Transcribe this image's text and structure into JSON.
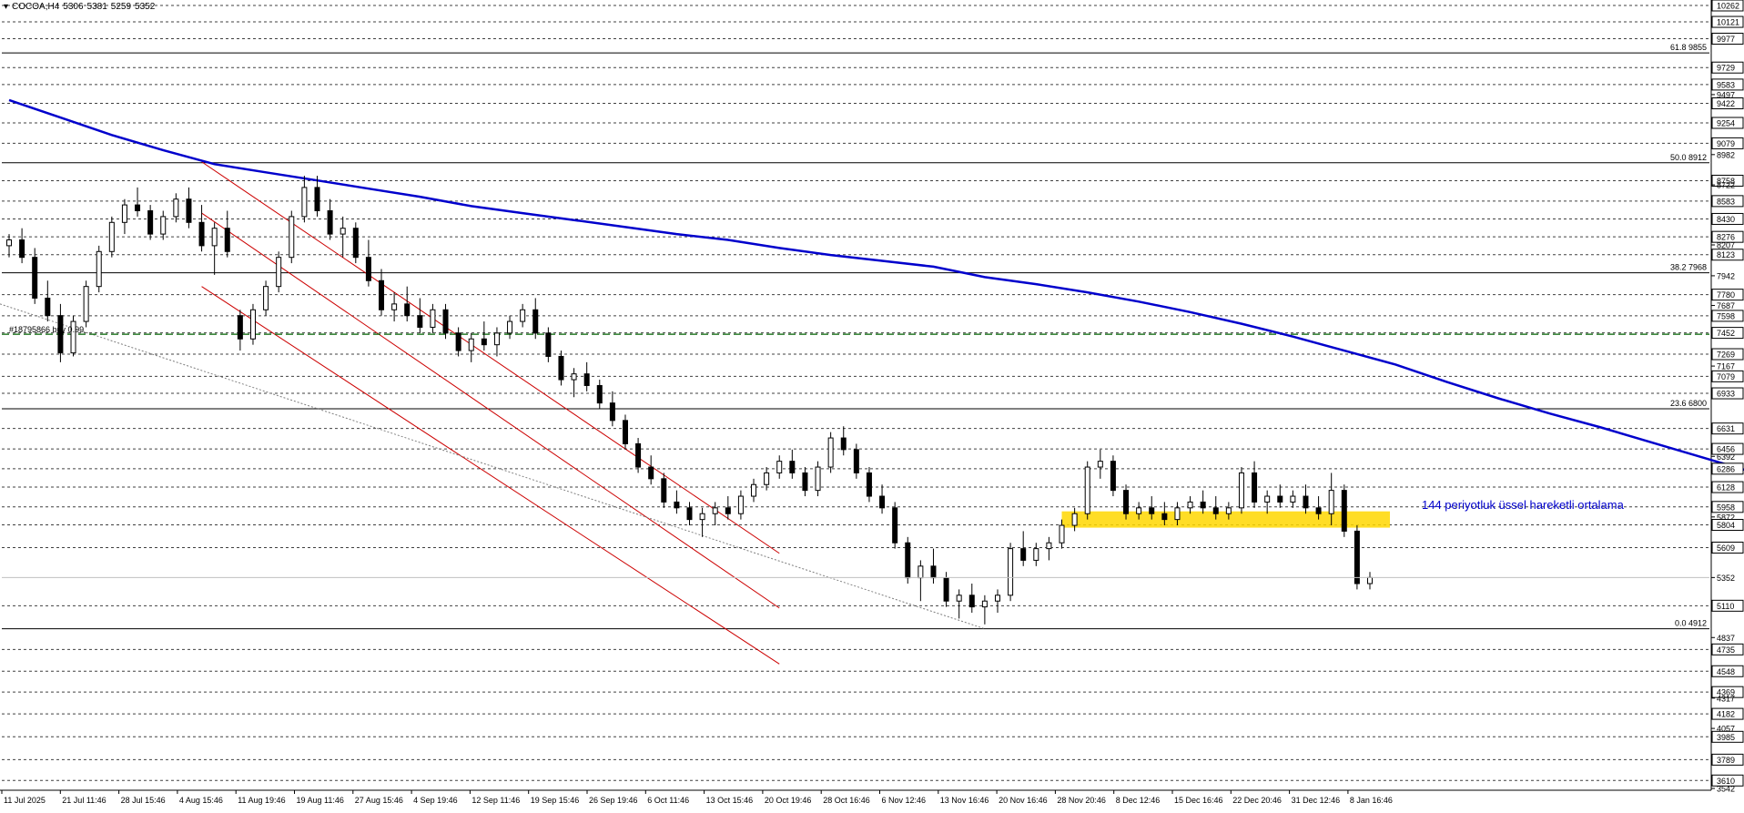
{
  "header": {
    "symbol": "COCOA,H4",
    "ohlc": [
      "5306",
      "5381",
      "5259",
      "5352"
    ]
  },
  "annotations": {
    "ema_label": "144 periyotluk üssel hareketli ortalama",
    "order_label": "#18795866 buy 0.99"
  },
  "colors": {
    "background": "#ffffff",
    "candle": "#000000",
    "ema": "#0000cc",
    "channel": "#cc0000",
    "fib": "#000000",
    "order_line": "#006400",
    "zone": "#ffd700",
    "grid": "#000000",
    "support_line": "#808080"
  },
  "chart_data": {
    "type": "candlestick",
    "instrument": "COCOA",
    "timeframe": "H4",
    "grid": true,
    "ylim": [
      3542,
      10262
    ],
    "price_axis_labels": [
      "10262",
      "10121",
      "9977",
      "9729",
      "9583",
      "9497",
      "9422",
      "9254",
      "9079",
      "8982",
      "8758",
      "8722",
      "8583",
      "8430",
      "8276",
      "8207",
      "8123",
      "7942",
      "7780",
      "7687",
      "7598",
      "7452",
      "7269",
      "7167",
      "7079",
      "6933",
      "6631",
      "6456",
      "6392",
      "6286",
      "6128",
      "5958",
      "5872",
      "5804",
      "5609",
      "5352",
      "5110",
      "4837",
      "4735",
      "4548",
      "4369",
      "4317",
      "4182",
      "4057",
      "3985",
      "3789",
      "3610",
      "3542"
    ],
    "dashed_grid_levels": [
      10262,
      10121,
      9977,
      9729,
      9583,
      9422,
      9254,
      9079,
      8758,
      8583,
      8430,
      8276,
      8123,
      7780,
      7598,
      7452,
      7269,
      7079,
      6933,
      6631,
      6456,
      6286,
      6128,
      5958,
      5804,
      5609,
      5110,
      4735,
      4548,
      4369,
      4182,
      3985,
      3789,
      3610
    ],
    "time_axis_labels": [
      "11 Jul 2025",
      "21 Jul 11:46",
      "28 Jul 15:46",
      "4 Aug 15:46",
      "11 Aug 19:46",
      "19 Aug 11:46",
      "27 Aug 15:46",
      "4 Sep 19:46",
      "12 Sep 11:46",
      "19 Sep 15:46",
      "26 Sep 19:46",
      "6 Oct 11:46",
      "13 Oct 15:46",
      "20 Oct 19:46",
      "28 Oct 16:46",
      "6 Nov 12:46",
      "13 Nov 16:46",
      "20 Nov 16:46",
      "28 Nov 20:46",
      "8 Dec 12:46",
      "15 Dec 16:46",
      "22 Dec 20:46",
      "31 Dec 12:46",
      "8 Jan 16:46"
    ],
    "fibonacci_levels": [
      {
        "label": "61.8 9855",
        "price": 9855
      },
      {
        "label": "50.0 8912",
        "price": 8912
      },
      {
        "label": "38.2 7968",
        "price": 7968
      },
      {
        "label": "23.6 6800",
        "price": 6800
      },
      {
        "label": "0.0 4912",
        "price": 4912
      }
    ],
    "order_level": {
      "label": "#18795866 buy 0.99",
      "price": 7440
    },
    "current_price": 5352,
    "ema_period": 144,
    "ema_points": [
      [
        0,
        9450
      ],
      [
        4,
        9300
      ],
      [
        8,
        9150
      ],
      [
        12,
        9020
      ],
      [
        16,
        8900
      ],
      [
        20,
        8830
      ],
      [
        24,
        8760
      ],
      [
        28,
        8690
      ],
      [
        32,
        8620
      ],
      [
        36,
        8540
      ],
      [
        40,
        8480
      ],
      [
        44,
        8420
      ],
      [
        48,
        8360
      ],
      [
        52,
        8300
      ],
      [
        56,
        8250
      ],
      [
        60,
        8180
      ],
      [
        64,
        8120
      ],
      [
        68,
        8070
      ],
      [
        72,
        8020
      ],
      [
        76,
        7930
      ],
      [
        80,
        7870
      ],
      [
        84,
        7800
      ],
      [
        88,
        7720
      ],
      [
        92,
        7630
      ],
      [
        96,
        7530
      ],
      [
        100,
        7420
      ],
      [
        104,
        7300
      ],
      [
        108,
        7180
      ],
      [
        112,
        7030
      ],
      [
        116,
        6890
      ],
      [
        120,
        6760
      ],
      [
        124,
        6640
      ],
      [
        128,
        6510
      ],
      [
        132,
        6380
      ],
      [
        136,
        6250
      ],
      [
        140,
        6110
      ],
      [
        144,
        5990
      ],
      [
        148,
        5900
      ],
      [
        152,
        5870
      ],
      [
        156,
        5860
      ],
      [
        160,
        5860
      ],
      [
        164,
        5865
      ],
      [
        168,
        5870
      ],
      [
        172,
        5870
      ],
      [
        176,
        5862
      ],
      [
        180,
        5860
      ],
      [
        184,
        5855
      ]
    ],
    "candles": [
      [
        0,
        8200,
        8300,
        8100,
        8250
      ],
      [
        1,
        8250,
        8350,
        8050,
        8100
      ],
      [
        2,
        8100,
        8180,
        7700,
        7750
      ],
      [
        3,
        7750,
        7900,
        7550,
        7600
      ],
      [
        4,
        7600,
        7700,
        7200,
        7280
      ],
      [
        5,
        7280,
        7600,
        7250,
        7550
      ],
      [
        6,
        7550,
        7900,
        7500,
        7850
      ],
      [
        7,
        7850,
        8200,
        7800,
        8150
      ],
      [
        8,
        8150,
        8450,
        8100,
        8400
      ],
      [
        9,
        8400,
        8600,
        8300,
        8550
      ],
      [
        10,
        8550,
        8700,
        8450,
        8500
      ],
      [
        11,
        8500,
        8550,
        8250,
        8300
      ],
      [
        12,
        8300,
        8500,
        8250,
        8450
      ],
      [
        13,
        8450,
        8650,
        8400,
        8600
      ],
      [
        14,
        8600,
        8700,
        8350,
        8400
      ],
      [
        15,
        8400,
        8550,
        8150,
        8200
      ],
      [
        16,
        8200,
        8400,
        7950,
        8350
      ],
      [
        17,
        8350,
        8500,
        8100,
        8150
      ],
      [
        18,
        7600,
        7650,
        7300,
        7400
      ],
      [
        19,
        7400,
        7700,
        7350,
        7650
      ],
      [
        20,
        7650,
        7900,
        7600,
        7850
      ],
      [
        21,
        7850,
        8150,
        7800,
        8100
      ],
      [
        22,
        8100,
        8500,
        8050,
        8450
      ],
      [
        23,
        8450,
        8800,
        8400,
        8700
      ],
      [
        24,
        8700,
        8800,
        8450,
        8500
      ],
      [
        25,
        8500,
        8600,
        8250,
        8300
      ],
      [
        26,
        8300,
        8450,
        8100,
        8350
      ],
      [
        27,
        8350,
        8400,
        8050,
        8100
      ],
      [
        28,
        8100,
        8250,
        7850,
        7900
      ],
      [
        29,
        7900,
        8000,
        7600,
        7650
      ],
      [
        30,
        7650,
        7800,
        7550,
        7700
      ],
      [
        31,
        7700,
        7850,
        7550,
        7600
      ],
      [
        32,
        7600,
        7750,
        7450,
        7500
      ],
      [
        33,
        7500,
        7700,
        7450,
        7650
      ],
      [
        34,
        7650,
        7700,
        7400,
        7450
      ],
      [
        35,
        7450,
        7500,
        7250,
        7300
      ],
      [
        36,
        7300,
        7450,
        7200,
        7400
      ],
      [
        37,
        7400,
        7550,
        7300,
        7350
      ],
      [
        38,
        7350,
        7500,
        7250,
        7450
      ],
      [
        39,
        7450,
        7600,
        7400,
        7550
      ],
      [
        40,
        7550,
        7700,
        7500,
        7650
      ],
      [
        41,
        7650,
        7750,
        7400,
        7450
      ],
      [
        42,
        7450,
        7500,
        7200,
        7250
      ],
      [
        43,
        7250,
        7300,
        7000,
        7050
      ],
      [
        44,
        7050,
        7150,
        6900,
        7100
      ],
      [
        45,
        7100,
        7200,
        6950,
        7000
      ],
      [
        46,
        7000,
        7050,
        6800,
        6850
      ],
      [
        47,
        6850,
        6950,
        6650,
        6700
      ],
      [
        48,
        6700,
        6750,
        6450,
        6500
      ],
      [
        49,
        6500,
        6550,
        6250,
        6300
      ],
      [
        50,
        6300,
        6400,
        6150,
        6200
      ],
      [
        51,
        6200,
        6250,
        5950,
        6000
      ],
      [
        52,
        6000,
        6100,
        5900,
        5950
      ],
      [
        53,
        5950,
        6000,
        5800,
        5850
      ],
      [
        54,
        5850,
        5950,
        5700,
        5900
      ],
      [
        55,
        5900,
        6000,
        5800,
        5950
      ],
      [
        56,
        5950,
        6050,
        5850,
        5900
      ],
      [
        57,
        5900,
        6100,
        5850,
        6050
      ],
      [
        58,
        6050,
        6200,
        6000,
        6150
      ],
      [
        59,
        6150,
        6300,
        6100,
        6250
      ],
      [
        60,
        6250,
        6400,
        6200,
        6350
      ],
      [
        61,
        6350,
        6450,
        6200,
        6250
      ],
      [
        62,
        6250,
        6300,
        6050,
        6100
      ],
      [
        63,
        6100,
        6350,
        6050,
        6300
      ],
      [
        64,
        6300,
        6600,
        6250,
        6550
      ],
      [
        65,
        6550,
        6650,
        6400,
        6450
      ],
      [
        66,
        6450,
        6500,
        6200,
        6250
      ],
      [
        67,
        6250,
        6300,
        6000,
        6050
      ],
      [
        68,
        6050,
        6150,
        5900,
        5950
      ],
      [
        69,
        5950,
        6000,
        5600,
        5650
      ],
      [
        70,
        5650,
        5700,
        5300,
        5350
      ],
      [
        71,
        5350,
        5500,
        5150,
        5450
      ],
      [
        72,
        5450,
        5600,
        5300,
        5350
      ],
      [
        73,
        5350,
        5400,
        5100,
        5150
      ],
      [
        74,
        5150,
        5250,
        5000,
        5200
      ],
      [
        75,
        5200,
        5300,
        5050,
        5100
      ],
      [
        76,
        5100,
        5200,
        4950,
        5150
      ],
      [
        77,
        5150,
        5250,
        5050,
        5200
      ],
      [
        78,
        5200,
        5650,
        5150,
        5600
      ],
      [
        79,
        5600,
        5750,
        5450,
        5500
      ],
      [
        80,
        5500,
        5650,
        5450,
        5600
      ],
      [
        81,
        5600,
        5700,
        5500,
        5650
      ],
      [
        82,
        5650,
        5850,
        5600,
        5800
      ],
      [
        83,
        5800,
        5950,
        5750,
        5900
      ],
      [
        84,
        5900,
        6350,
        5850,
        6300
      ],
      [
        85,
        6300,
        6450,
        6200,
        6350
      ],
      [
        86,
        6350,
        6400,
        6050,
        6100
      ],
      [
        87,
        6100,
        6150,
        5850,
        5900
      ],
      [
        88,
        5900,
        6000,
        5850,
        5950
      ],
      [
        89,
        5950,
        6050,
        5850,
        5900
      ],
      [
        90,
        5900,
        6000,
        5800,
        5850
      ],
      [
        91,
        5850,
        6000,
        5800,
        5950
      ],
      [
        92,
        5950,
        6050,
        5900,
        6000
      ],
      [
        93,
        6000,
        6100,
        5900,
        5950
      ],
      [
        94,
        5950,
        6050,
        5850,
        5900
      ],
      [
        95,
        5900,
        6000,
        5850,
        5950
      ],
      [
        96,
        5950,
        6300,
        5900,
        6250
      ],
      [
        97,
        6250,
        6350,
        5950,
        6000
      ],
      [
        98,
        6000,
        6100,
        5900,
        6050
      ],
      [
        99,
        6050,
        6150,
        5950,
        6000
      ],
      [
        100,
        6000,
        6100,
        5950,
        6050
      ],
      [
        101,
        6050,
        6150,
        5900,
        5950
      ],
      [
        102,
        5950,
        6050,
        5850,
        5900
      ],
      [
        103,
        5900,
        6250,
        5800,
        6100
      ],
      [
        104,
        6100,
        6150,
        5700,
        5750
      ],
      [
        105,
        5750,
        5800,
        5250,
        5300
      ],
      [
        106,
        5300,
        5400,
        5250,
        5352
      ]
    ]
  }
}
